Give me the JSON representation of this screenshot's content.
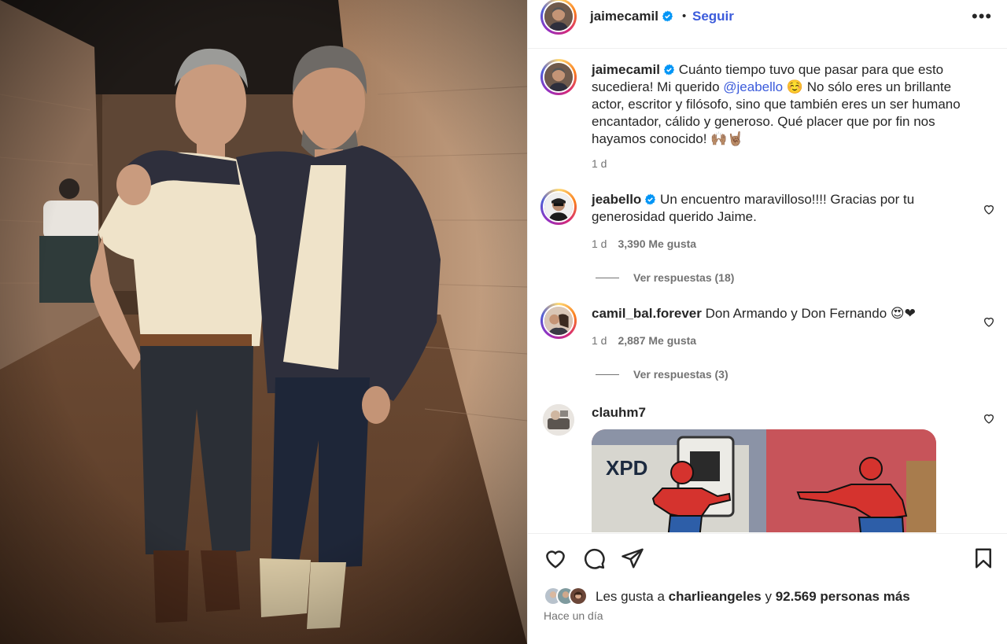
{
  "header": {
    "username": "jaimecamil",
    "dot": "•",
    "follow_label": "Seguir",
    "more_label": "•••"
  },
  "caption": {
    "username": "jaimecamil",
    "text_before": "Cuánto tiempo tuvo que pasar para que esto sucediera! Mi querido ",
    "mention": "@jeabello",
    "text_after": " ☺️ No sólo eres un brillante actor, escritor y filósofo, sino que también eres un ser humano encantador, cálido y generoso. Qué placer que por fin nos hayamos conocido! 🙌🏽🤘🏽",
    "time": "1 d"
  },
  "comments": [
    {
      "username": "jeabello",
      "verified": true,
      "text": "Un encuentro maravilloso!!!! Gracias por tu generosidad querido Jaime.",
      "time": "1 d",
      "likes": "3,390 Me gusta",
      "replies": "Ver respuestas (18)"
    },
    {
      "username": "camil_bal.forever",
      "verified": false,
      "text": "Don Armando y Don Fernando 😍❤",
      "time": "1 d",
      "likes": "2,887 Me gusta",
      "replies": "Ver respuestas (3)"
    },
    {
      "username": "clauhm7",
      "verified": false,
      "text": "",
      "gif_text": "XPD"
    }
  ],
  "footer": {
    "likes_prefix": "Les gusta a ",
    "liked_by": "charlieangeles",
    "likes_mid": " y ",
    "likes_count": "92.569 personas más",
    "posted": "Hace un día"
  },
  "icons": {
    "verified": "verified-badge-icon",
    "like": "heart-icon",
    "comment": "comment-bubble-icon",
    "share": "paper-plane-icon",
    "save": "bookmark-icon",
    "more": "more-options-icon"
  },
  "colors": {
    "link_blue": "#3b5bdb",
    "verified_blue": "#0095f6",
    "muted": "#737373",
    "text": "#262626"
  }
}
